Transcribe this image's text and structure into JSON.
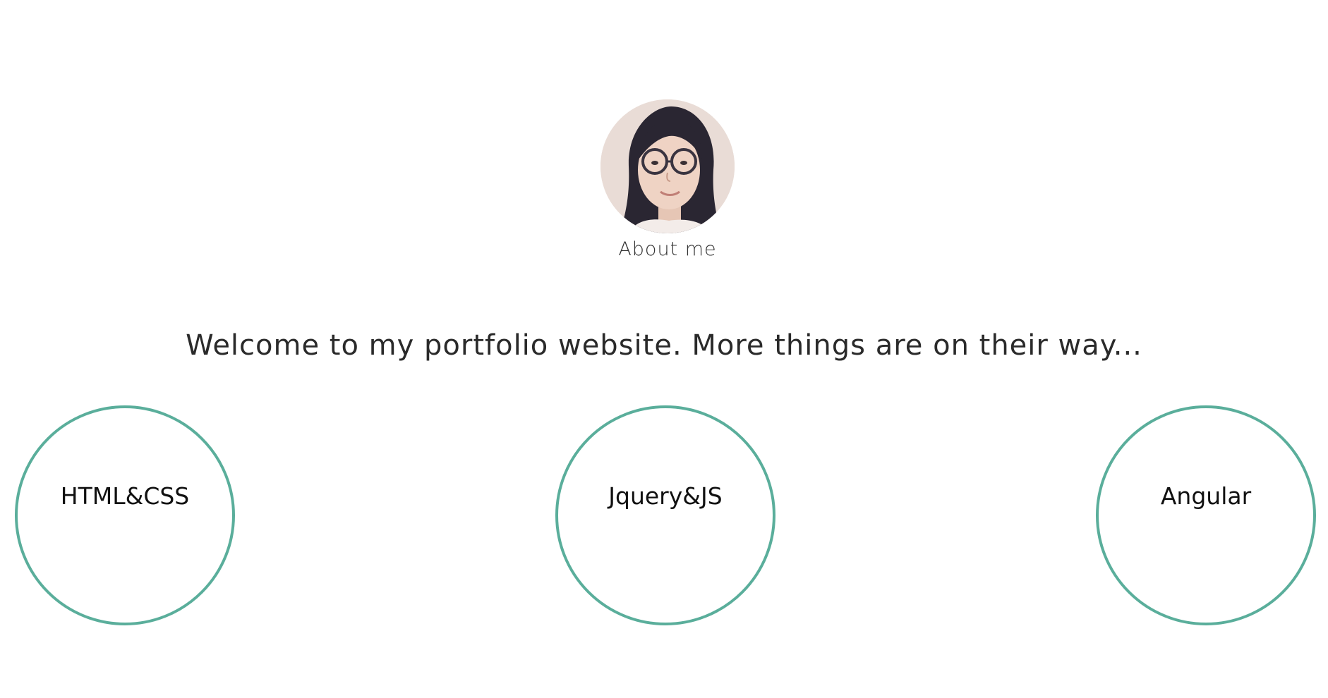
{
  "profile": {
    "about_label": "About me"
  },
  "welcome": {
    "text": "Welcome to my portfolio website. More things are on their way..."
  },
  "skills": [
    {
      "label": "HTML&CSS"
    },
    {
      "label": "Jquery&JS"
    },
    {
      "label": "Angular"
    }
  ],
  "colors": {
    "circle_border": "#5aae9b",
    "text": "#2a2a2a",
    "background": "#ffffff"
  }
}
